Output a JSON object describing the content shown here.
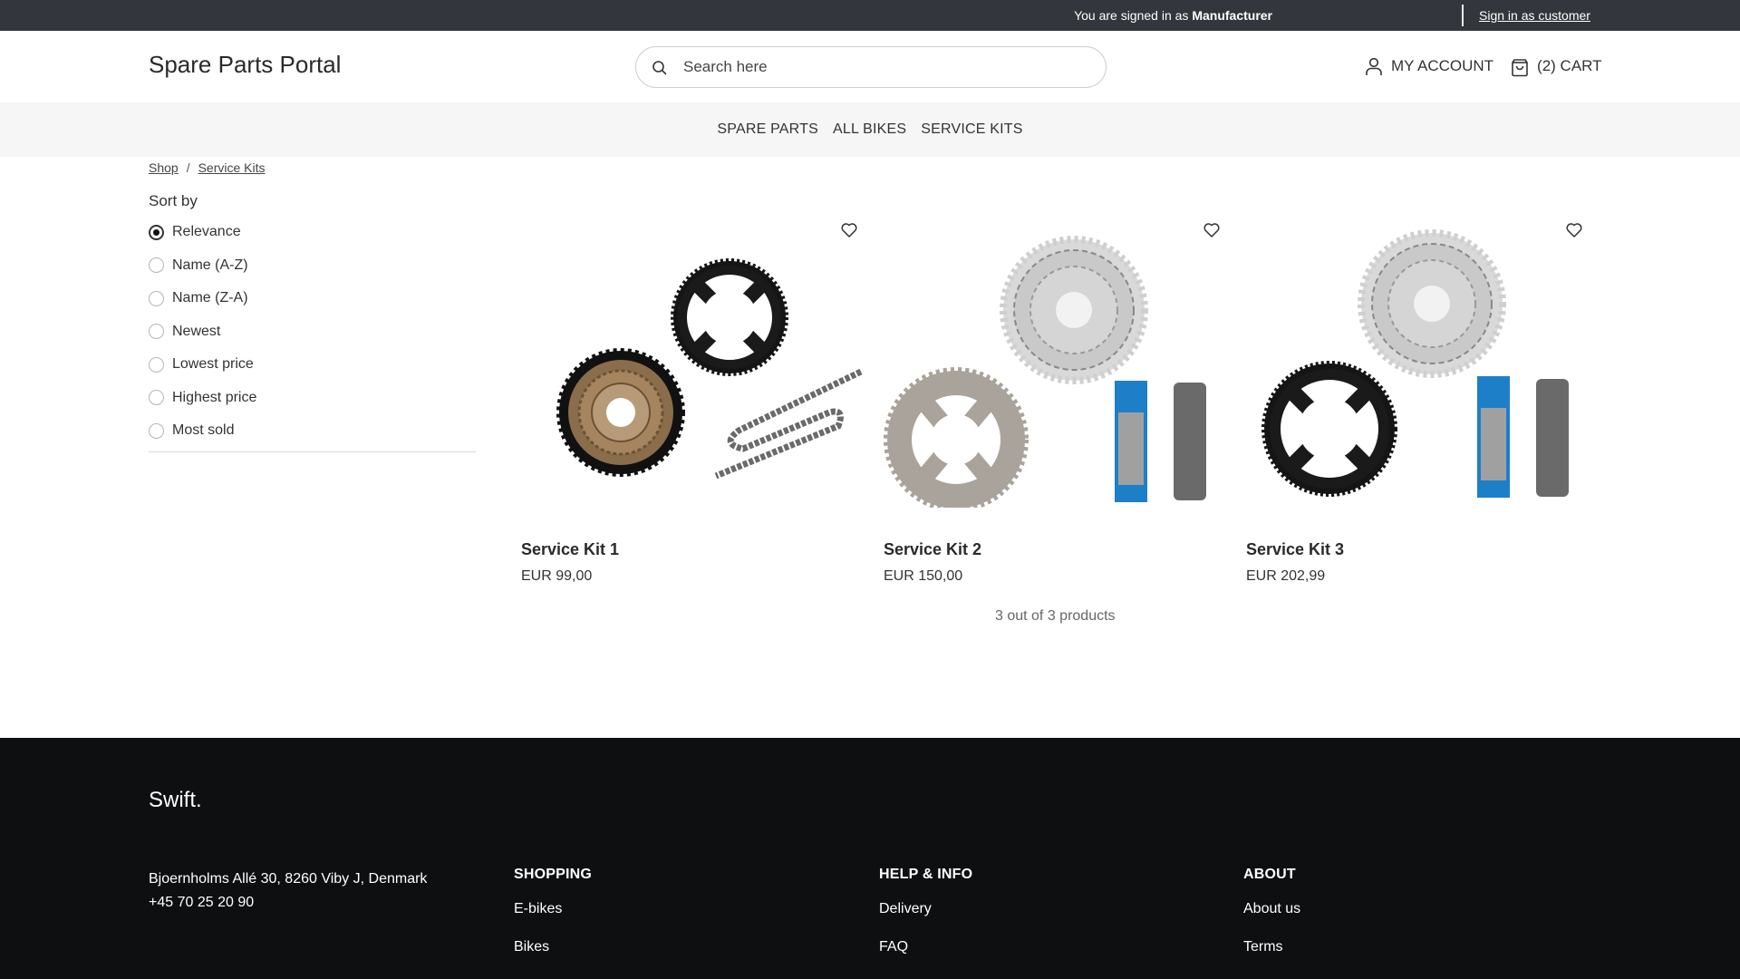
{
  "topbar": {
    "signed_prefix": "You are signed in as ",
    "signed_role": "Manufacturer",
    "switch_link": "Sign in as customer"
  },
  "header": {
    "logo": "Spare Parts Portal",
    "search_placeholder": "Search here",
    "search_value": "",
    "account_label": "MY ACCOUNT",
    "cart_label": "(2) CART",
    "cart_count": 2
  },
  "nav": {
    "items": [
      "SPARE PARTS",
      "ALL BIKES",
      "SERVICE KITS"
    ]
  },
  "breadcrumb": [
    "Shop",
    "Service Kits"
  ],
  "sort": {
    "title": "Sort by",
    "selected": "Relevance",
    "options": [
      "Relevance",
      "Name (A-Z)",
      "Name (Z-A)",
      "Newest",
      "Lowest price",
      "Highest price",
      "Most sold"
    ]
  },
  "products": [
    {
      "title": "Service Kit 1",
      "price": "EUR 99,00",
      "image": "freewheel-chainring-chain"
    },
    {
      "title": "Service Kit 2",
      "price": "EUR 150,00",
      "image": "cassette-sprocket-chain-box"
    },
    {
      "title": "Service Kit 3",
      "price": "EUR 202,99",
      "image": "cassette-chainring-chain-box"
    }
  ],
  "result_count": "3 out of 3 products",
  "footer": {
    "brand": "Swift.",
    "address": "Bjoernholms Allé 30, 8260 Viby J, Denmark",
    "phone": "+45 70 25 20 90",
    "columns": [
      {
        "heading": "SHOPPING",
        "links": [
          "E-bikes",
          "Bikes"
        ]
      },
      {
        "heading": "HELP & INFO",
        "links": [
          "Delivery",
          "FAQ"
        ]
      },
      {
        "heading": "ABOUT",
        "links": [
          "About us",
          "Terms"
        ]
      }
    ]
  },
  "colors": {
    "topbar_bg": "#33363c",
    "nav_bg": "#f6f6f6",
    "footer_bg": "#0e0f11",
    "text": "#333333"
  }
}
